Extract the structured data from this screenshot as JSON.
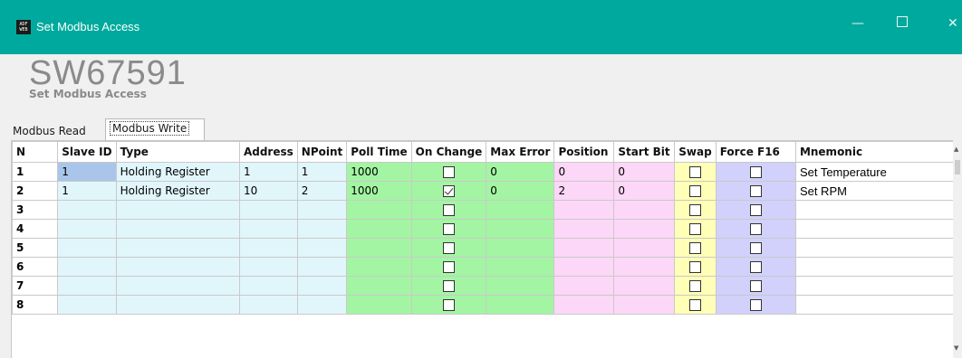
{
  "window": {
    "title": "Set Modbus Access",
    "icon_text": "ADF WEB",
    "min_glyph": "—",
    "close_glyph": "✕"
  },
  "header": {
    "product_code": "SW67591",
    "subtitle": "Set Modbus Access"
  },
  "tabs": [
    {
      "label": "Modbus Read",
      "active": false
    },
    {
      "label": "Modbus Write",
      "active": true
    }
  ],
  "grid": {
    "columns": [
      "N",
      "Slave ID",
      "Type",
      "Address",
      "NPoint",
      "Poll Time",
      "On Change",
      "Max Error",
      "Position",
      "Start Bit",
      "Swap",
      "Force F16",
      "Mnemonic"
    ],
    "rows": [
      {
        "n": "1",
        "slave_id": "1",
        "type": "Holding Register",
        "address": "1",
        "npoint": "1",
        "poll_time": "1000",
        "on_change": false,
        "max_error": "0",
        "position": "0",
        "start_bit": "0",
        "swap": false,
        "force_f16": false,
        "mnemonic": "Set Temperature"
      },
      {
        "n": "2",
        "slave_id": "1",
        "type": "Holding Register",
        "address": "10",
        "npoint": "2",
        "poll_time": "1000",
        "on_change": true,
        "max_error": "0",
        "position": "2",
        "start_bit": "0",
        "swap": false,
        "force_f16": false,
        "mnemonic": "Set RPM"
      },
      {
        "n": "3",
        "slave_id": "",
        "type": "",
        "address": "",
        "npoint": "",
        "poll_time": "",
        "on_change": false,
        "max_error": "",
        "position": "",
        "start_bit": "",
        "swap": false,
        "force_f16": false,
        "mnemonic": ""
      },
      {
        "n": "4",
        "slave_id": "",
        "type": "",
        "address": "",
        "npoint": "",
        "poll_time": "",
        "on_change": false,
        "max_error": "",
        "position": "",
        "start_bit": "",
        "swap": false,
        "force_f16": false,
        "mnemonic": ""
      },
      {
        "n": "5",
        "slave_id": "",
        "type": "",
        "address": "",
        "npoint": "",
        "poll_time": "",
        "on_change": false,
        "max_error": "",
        "position": "",
        "start_bit": "",
        "swap": false,
        "force_f16": false,
        "mnemonic": ""
      },
      {
        "n": "6",
        "slave_id": "",
        "type": "",
        "address": "",
        "npoint": "",
        "poll_time": "",
        "on_change": false,
        "max_error": "",
        "position": "",
        "start_bit": "",
        "swap": false,
        "force_f16": false,
        "mnemonic": ""
      },
      {
        "n": "7",
        "slave_id": "",
        "type": "",
        "address": "",
        "npoint": "",
        "poll_time": "",
        "on_change": false,
        "max_error": "",
        "position": "",
        "start_bit": "",
        "swap": false,
        "force_f16": false,
        "mnemonic": ""
      },
      {
        "n": "8",
        "slave_id": "",
        "type": "",
        "address": "",
        "npoint": "",
        "poll_time": "",
        "on_change": false,
        "max_error": "",
        "position": "",
        "start_bit": "",
        "swap": false,
        "force_f16": false,
        "mnemonic": ""
      }
    ]
  },
  "colors": {
    "titlebar": "#00a99d",
    "general_cols": "#e1f6fb",
    "timing_cols": "#a3f5a3",
    "position_cols": "#fcd7f7",
    "swap_col": "#ffffb7",
    "force_f16_col": "#d1d1fb",
    "selected_cell": "#a9c6ea"
  }
}
